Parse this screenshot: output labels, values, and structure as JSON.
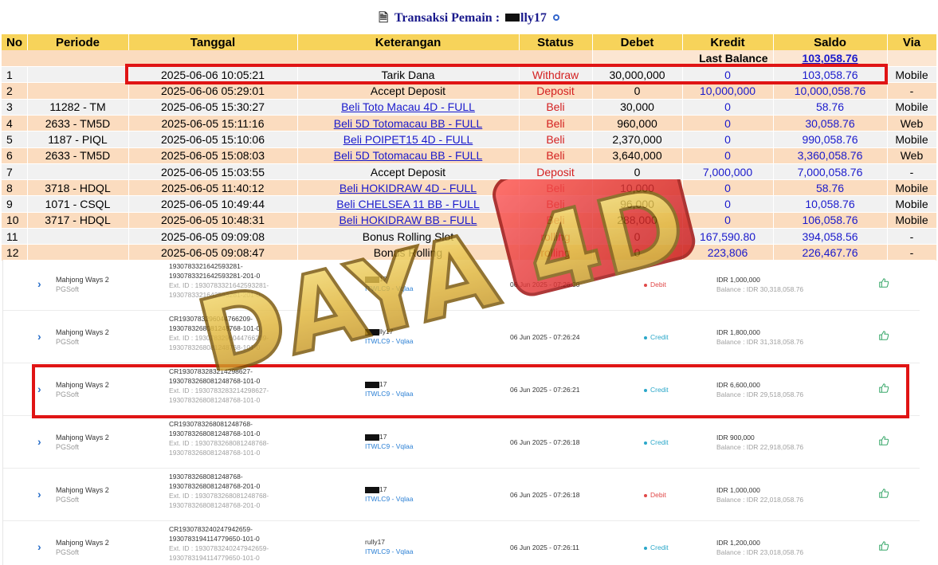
{
  "title": {
    "icon": "document-icon",
    "prefix": "Transaksi  Pemain :",
    "username_suffix": "lly17"
  },
  "table": {
    "headers": [
      "No",
      "Periode",
      "Tanggal",
      "Keterangan",
      "Status",
      "Debet",
      "Kredit",
      "Saldo",
      "Via"
    ],
    "last_balance_label": "Last Balance",
    "last_balance_value": "103,058.76",
    "rows": [
      {
        "no": "1",
        "periode": "",
        "tanggal": "2025-06-06 10:05:21",
        "keterangan": "Tarik Dana",
        "link": false,
        "status": "Withdraw",
        "debet": "30,000,000",
        "kredit": "0",
        "saldo": "103,058.76",
        "via": "Mobile"
      },
      {
        "no": "2",
        "periode": "",
        "tanggal": "2025-06-06 05:29:01",
        "keterangan": "Accept Deposit",
        "link": false,
        "status": "Deposit",
        "debet": "0",
        "kredit": "10,000,000",
        "saldo": "10,000,058.76",
        "via": "-"
      },
      {
        "no": "3",
        "periode": "11282 - TM",
        "tanggal": "2025-06-05 15:30:27",
        "keterangan": "Beli Toto Macau 4D - FULL",
        "link": true,
        "status": "Beli",
        "debet": "30,000",
        "kredit": "0",
        "saldo": "58.76",
        "via": "Mobile"
      },
      {
        "no": "4",
        "periode": "2633 - TM5D",
        "tanggal": "2025-06-05 15:11:16",
        "keterangan": "Beli 5D Totomacau BB - FULL",
        "link": true,
        "status": "Beli",
        "debet": "960,000",
        "kredit": "0",
        "saldo": "30,058.76",
        "via": "Web"
      },
      {
        "no": "5",
        "periode": "1187 - PIQL",
        "tanggal": "2025-06-05 15:10:06",
        "keterangan": "Beli POIPET15 4D - FULL",
        "link": true,
        "status": "Beli",
        "debet": "2,370,000",
        "kredit": "0",
        "saldo": "990,058.76",
        "via": "Mobile"
      },
      {
        "no": "6",
        "periode": "2633 - TM5D",
        "tanggal": "2025-06-05 15:08:03",
        "keterangan": "Beli 5D Totomacau BB - FULL",
        "link": true,
        "status": "Beli",
        "debet": "3,640,000",
        "kredit": "0",
        "saldo": "3,360,058.76",
        "via": "Web"
      },
      {
        "no": "7",
        "periode": "",
        "tanggal": "2025-06-05 15:03:55",
        "keterangan": "Accept Deposit",
        "link": false,
        "status": "Deposit",
        "debet": "0",
        "kredit": "7,000,000",
        "saldo": "7,000,058.76",
        "via": "-"
      },
      {
        "no": "8",
        "periode": "3718 - HDQL",
        "tanggal": "2025-06-05 11:40:12",
        "keterangan": "Beli HOKIDRAW 4D - FULL",
        "link": true,
        "status": "Beli",
        "debet": "10,000",
        "kredit": "0",
        "saldo": "58.76",
        "via": "Mobile"
      },
      {
        "no": "9",
        "periode": "1071 - CSQL",
        "tanggal": "2025-06-05 10:49:44",
        "keterangan": "Beli CHELSEA 11 BB - FULL",
        "link": true,
        "status": "Beli",
        "debet": "96,000",
        "kredit": "0",
        "saldo": "10,058.76",
        "via": "Mobile"
      },
      {
        "no": "10",
        "periode": "3717 - HDQL",
        "tanggal": "2025-06-05 10:48:31",
        "keterangan": "Beli HOKIDRAW BB - FULL",
        "link": true,
        "status": "Beli",
        "debet": "288,000",
        "kredit": "0",
        "saldo": "106,058.76",
        "via": "Mobile"
      },
      {
        "no": "11",
        "periode": "",
        "tanggal": "2025-06-05 09:09:08",
        "keterangan": "Bonus Rolling Slot",
        "link": false,
        "status": "rolling",
        "debet": "0",
        "kredit": "167,590.80",
        "saldo": "394,058.56",
        "via": "-"
      },
      {
        "no": "12",
        "periode": "",
        "tanggal": "2025-06-05 09:08:47",
        "keterangan": "Bonus Rolling",
        "link": false,
        "status": "rolling",
        "debet": "0",
        "kredit": "223,806",
        "saldo": "226,467.76",
        "via": "-"
      }
    ]
  },
  "history": [
    {
      "game": "Mahjong Ways 2",
      "provider": "PGSoft",
      "id1": "1930783321642593281-",
      "id2": "1930783321642593281-201-0",
      "ext1": "Ext. ID : 1930783321642593281-",
      "ext2": "1930783321642593281-201-0",
      "user_suffix": "17",
      "user_masked": true,
      "agent": "ITWLC9 - Vqlaa",
      "date": "06 Jun 2025 - 07:26:30",
      "type": "Debit",
      "amount": "IDR 1,000,000",
      "balance": "Balance : IDR 30,318,058.76"
    },
    {
      "game": "Mahjong Ways 2",
      "provider": "PGSoft",
      "id1": "CR1930783296044766209-",
      "id2": "1930783268081248768-101-0",
      "ext1": "Ext. ID : 1930783296044766209-",
      "ext2": "1930783268081248768-101-0",
      "user_suffix": "lly17",
      "user_masked": true,
      "agent": "ITWLC9 - Vqlaa",
      "date": "06 Jun 2025 - 07:26:24",
      "type": "Credit",
      "amount": "IDR 1,800,000",
      "balance": "Balance : IDR 31,318,058.76"
    },
    {
      "game": "Mahjong Ways 2",
      "provider": "PGSoft",
      "id1": "CR1930783283214298627-",
      "id2": "1930783268081248768-101-0",
      "ext1": "Ext. ID : 1930783283214298627-",
      "ext2": "1930783268081248768-101-0",
      "user_suffix": "17",
      "user_masked": true,
      "agent": "ITWLC9 - Vqlaa",
      "date": "06 Jun 2025 - 07:26:21",
      "type": "Credit",
      "amount": "IDR 6,600,000",
      "balance": "Balance : IDR 29,518,058.76"
    },
    {
      "game": "Mahjong Ways 2",
      "provider": "PGSoft",
      "id1": "CR1930783268081248768-",
      "id2": "1930783268081248768-101-0",
      "ext1": "Ext. ID : 1930783268081248768-",
      "ext2": "1930783268081248768-101-0",
      "user_suffix": "17",
      "user_masked": true,
      "agent": "ITWLC9 - Vqlaa",
      "date": "06 Jun 2025 - 07:26:18",
      "type": "Credit",
      "amount": "IDR 900,000",
      "balance": "Balance : IDR 22,918,058.76"
    },
    {
      "game": "Mahjong Ways 2",
      "provider": "PGSoft",
      "id1": "1930783268081248768-",
      "id2": "1930783268081248768-201-0",
      "ext1": "Ext. ID : 1930783268081248768-",
      "ext2": "1930783268081248768-201-0",
      "user_suffix": "17",
      "user_masked": true,
      "agent": "ITWLC9 - Vqlaa",
      "date": "06 Jun 2025 - 07:26:18",
      "type": "Debit",
      "amount": "IDR 1,000,000",
      "balance": "Balance : IDR 22,018,058.76"
    },
    {
      "game": "Mahjong Ways 2",
      "provider": "PGSoft",
      "id1": "CR1930783240247942659-",
      "id2": "1930783194114779650-101-0",
      "ext1": "Ext. ID : 1930783240247942659-",
      "ext2": "1930783194114779650-101-0",
      "user_suffix": "rully17",
      "user_masked": false,
      "agent": "ITWLC9 - Vqlaa",
      "date": "06 Jun 2025 - 07:26:11",
      "type": "Credit",
      "amount": "IDR 1,200,000",
      "balance": "Balance : IDR 23,018,058.76"
    }
  ],
  "watermark": {
    "text": "DAYA 4D"
  },
  "colors": {
    "header_bg": "#f7d35a",
    "row_peach": "#fbdcbf",
    "row_gray": "#f1f1f1",
    "link_blue": "#1a1acc",
    "status_red": "#d42020",
    "highlight_red": "#e01414",
    "credit": "#2aa7c9",
    "debit": "#e04848"
  }
}
